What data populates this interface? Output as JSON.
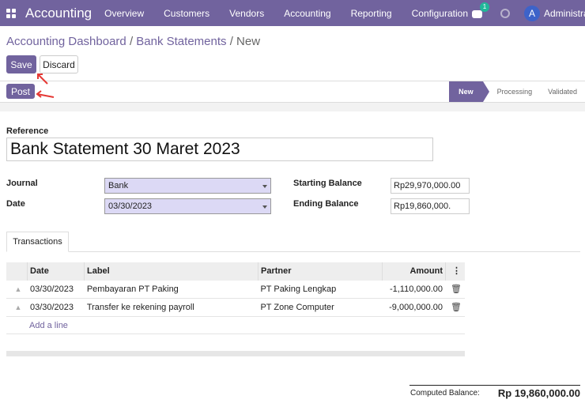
{
  "topbar": {
    "app_name": "Accounting",
    "menu": [
      "Overview",
      "Customers",
      "Vendors",
      "Accounting",
      "Reporting",
      "Configuration"
    ],
    "chat_count": "1",
    "avatar_letter": "A",
    "user_name": "Administrator",
    "colors": {
      "primary": "#71639e",
      "badge": "#21b799"
    }
  },
  "breadcrumb": {
    "item1": "Accounting Dashboard",
    "item2": "Bank Statements",
    "current": "New",
    "sep": "/"
  },
  "buttons": {
    "save": "Save",
    "discard": "Discard",
    "post": "Post"
  },
  "status_steps": [
    "New",
    "Processing",
    "Validated"
  ],
  "form": {
    "reference_label": "Reference",
    "reference_value": "Bank Statement 30 Maret 2023",
    "journal_label": "Journal",
    "journal_value": "Bank",
    "date_label": "Date",
    "date_value": "03/30/2023",
    "starting_balance_label": "Starting Balance",
    "starting_balance_value": "Rp29,970,000.00",
    "ending_balance_label": "Ending Balance",
    "ending_balance_value": "Rp19,860,000."
  },
  "tabs": {
    "transactions": "Transactions"
  },
  "table": {
    "headers": {
      "date": "Date",
      "label": "Label",
      "partner": "Partner",
      "amount": "Amount",
      "options": "⋮"
    },
    "rows": [
      {
        "date": "03/30/2023",
        "label": "Pembayaran PT Paking",
        "partner": "PT Paking Lengkap",
        "amount": "-1,110,000.00"
      },
      {
        "date": "03/30/2023",
        "label": "Transfer ke rekening payroll",
        "partner": "PT Zone Computer",
        "amount": "-9,000,000.00"
      }
    ],
    "add_line": "Add a line"
  },
  "summary": {
    "computed_label": "Computed Balance:",
    "computed_value": "Rp 19,860,000.00"
  }
}
